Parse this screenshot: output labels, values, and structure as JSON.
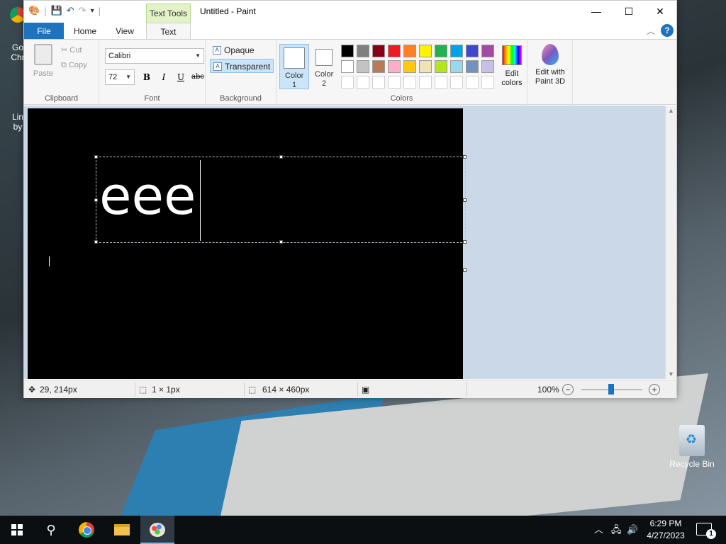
{
  "window": {
    "title": "Untitled - Paint",
    "context_tab": "Text Tools",
    "controls": {
      "minimize": "—",
      "maximize": "☐",
      "close": "✕"
    }
  },
  "tabs": [
    {
      "label": "File"
    },
    {
      "label": "Home"
    },
    {
      "label": "View"
    },
    {
      "label": "Text"
    }
  ],
  "ribbon": {
    "clipboard": {
      "label": "Clipboard",
      "paste": "Paste",
      "cut": "Cut",
      "copy": "Copy"
    },
    "font": {
      "label": "Font",
      "family": "Calibri",
      "size": "72",
      "bold": "B",
      "italic": "I",
      "underline": "U",
      "strike": "abc"
    },
    "background": {
      "label": "Background",
      "opaque": "Opaque",
      "transparent": "Transparent"
    },
    "colors": {
      "label": "Colors",
      "color1": "Color 1",
      "color2": "Color 2",
      "edit_colors": "Edit colors",
      "paint3d": "Edit with Paint 3D",
      "palette_row1": [
        "#000000",
        "#7f7f7f",
        "#880015",
        "#ed1c24",
        "#ff7f27",
        "#fff200",
        "#22b14c",
        "#00a2e8",
        "#3f48cc",
        "#a349a4"
      ],
      "palette_row2": [
        "#ffffff",
        "#c3c3c3",
        "#b97a57",
        "#ffaec9",
        "#ffc90e",
        "#efe4b0",
        "#b5e61d",
        "#99d9ea",
        "#7092be",
        "#c8bfe7"
      ]
    }
  },
  "canvas": {
    "typed_text": "eee"
  },
  "status": {
    "cursor_pos": "29, 214px",
    "selection_size": "1 × 1px",
    "image_size": "614 × 460px",
    "zoom": "100%"
  },
  "desktop": {
    "icon1": "Go\nChr",
    "icon2": "Lin\nby",
    "recycle_bin": "Recycle Bin"
  },
  "taskbar": {
    "time": "6:29 PM",
    "date": "4/27/2023",
    "notifications": "1"
  }
}
